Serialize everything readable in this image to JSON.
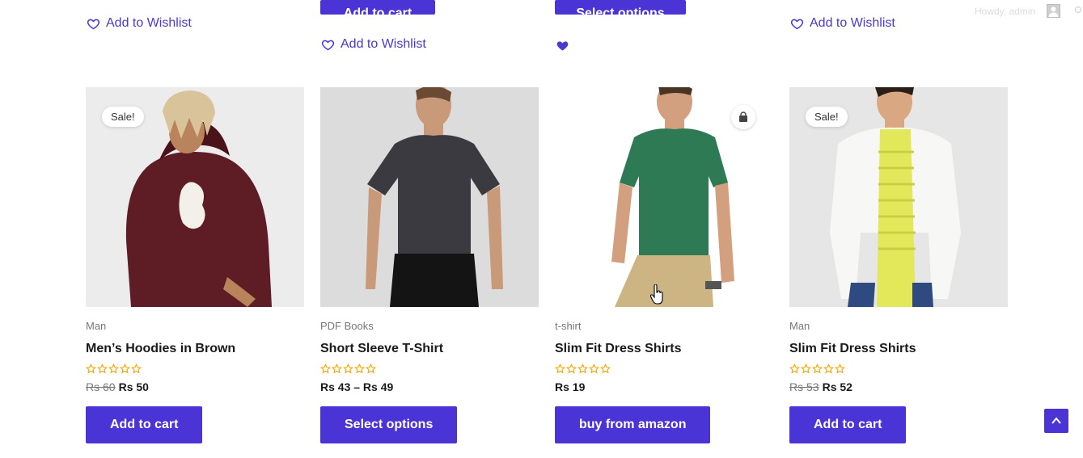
{
  "top_row": {
    "wishlist_label": "Add to Wishlist",
    "add_to_cart_label": "Add to cart",
    "select_options_label": "Select options"
  },
  "admin_bar": {
    "greeting": "Howdy, admin"
  },
  "products": [
    {
      "category": "Man",
      "title": "Men’s Hoodies in Brown",
      "badge": "Sale!",
      "old_price": "Rs 60",
      "price": "Rs 50",
      "button": "Add to cart",
      "rating": 0,
      "image_icon": "hoodie-photo"
    },
    {
      "category": "PDF Books",
      "title": "Short Sleeve T-Shirt",
      "price": "Rs 43 – Rs 49",
      "button": "Select options",
      "rating": 0,
      "image_icon": "tshirt-photo"
    },
    {
      "category": "t-shirt",
      "title": "Slim Fit Dress Shirts",
      "price": "Rs 19",
      "button": "buy from amazon",
      "rating": 0,
      "image_icon": "green-tshirt-photo",
      "badge_icon": "shopping-bag-icon"
    },
    {
      "category": "Man",
      "title": "Slim Fit Dress Shirts",
      "badge": "Sale!",
      "old_price": "Rs 53",
      "price": "Rs 52",
      "button": "Add to cart",
      "rating": 0,
      "image_icon": "white-shirt-photo"
    }
  ],
  "colors": {
    "accent": "#4a34d6",
    "link": "#4a3ad0",
    "star": "#f0a500"
  }
}
